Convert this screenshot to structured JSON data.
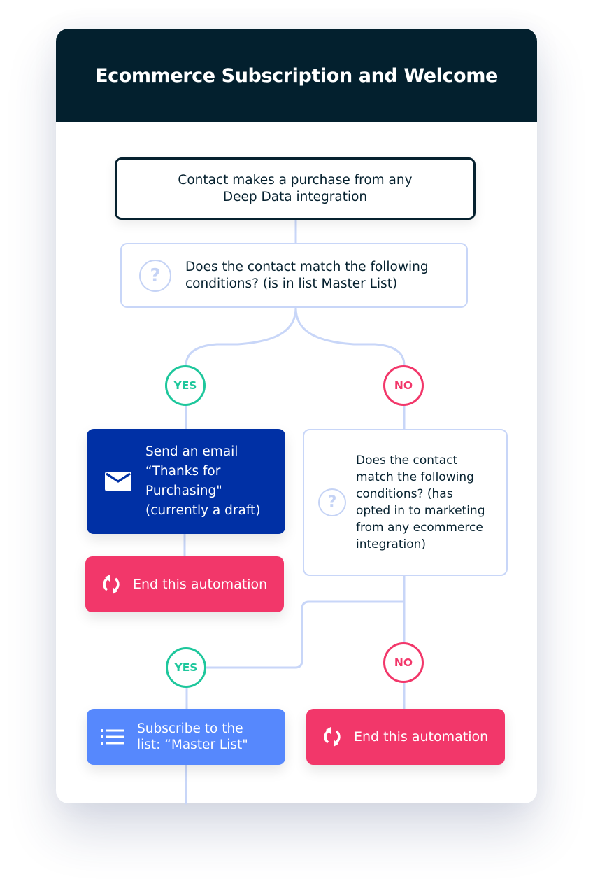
{
  "title": "Ecommerce Subscription and Welcome",
  "colors": {
    "header_bg": "#03202e",
    "connector": "#c8d6f8",
    "yes": "#1ec79c",
    "no": "#f2376a",
    "email_action": "#0030a5",
    "end_action": "#f2376a",
    "subscribe_action": "#5688fd"
  },
  "trigger": {
    "line1": "Contact makes a purchase from any",
    "line2": "Deep Data integration"
  },
  "condition_1": {
    "icon": "question-circle-icon",
    "line1": "Does the contact match the following",
    "line2": "conditions? (is in list Master List)"
  },
  "branch_1": {
    "yes_label": "YES",
    "no_label": "NO"
  },
  "email_action": {
    "icon": "envelope-icon",
    "lines": [
      "Send an email",
      "“Thanks for",
      "Purchasing\"",
      "(currently a draft)"
    ]
  },
  "end_action_1": {
    "icon": "refresh-icon",
    "label": "End this automation"
  },
  "condition_2": {
    "icon": "question-circle-icon",
    "lines": [
      "Does the contact",
      "match the following",
      "conditions? (has",
      "opted in to marketing",
      "from any ecommerce",
      "integration)"
    ]
  },
  "branch_2": {
    "yes_label": "YES",
    "no_label": "NO"
  },
  "subscribe_action": {
    "icon": "list-icon",
    "line1": "Subscribe to the",
    "line2": "list: “Master List\""
  },
  "end_action_2": {
    "icon": "refresh-icon",
    "label": "End this automation"
  }
}
